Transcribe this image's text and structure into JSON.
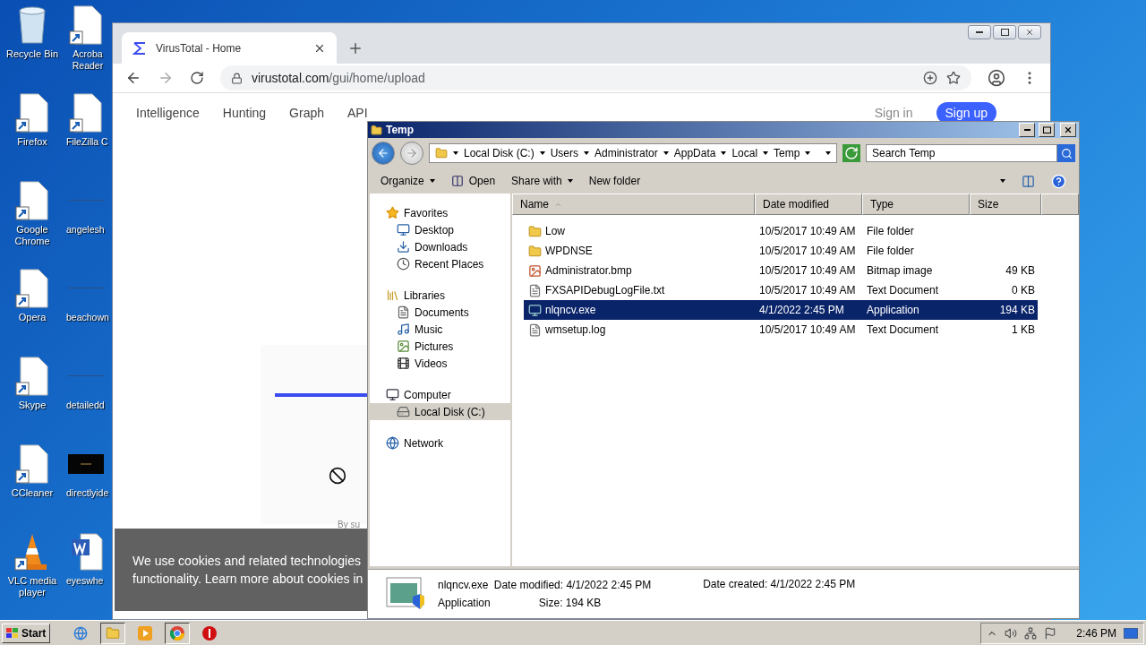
{
  "desktop": {
    "icons": [
      {
        "label": "Recycle Bin",
        "kind": "bin"
      },
      {
        "label": "Firefox",
        "kind": "shortcut"
      },
      {
        "label": "Google Chrome",
        "kind": "shortcut"
      },
      {
        "label": "Opera",
        "kind": "shortcut"
      },
      {
        "label": "Skype",
        "kind": "shortcut"
      },
      {
        "label": "CCleaner",
        "kind": "shortcut"
      },
      {
        "label": "VLC media player",
        "kind": "vlc"
      },
      {
        "label": "Acroba Reader",
        "kind": "shortcut"
      },
      {
        "label": "FileZilla C",
        "kind": "shortcut"
      },
      {
        "label": "angelesh",
        "kind": "blank"
      },
      {
        "label": "beachown",
        "kind": "blank"
      },
      {
        "label": "detailedd",
        "kind": "blank"
      },
      {
        "label": "directlyide",
        "kind": "thumbnail"
      },
      {
        "label": "eyeswhe",
        "kind": "word"
      }
    ]
  },
  "browser": {
    "tab": {
      "title": "VirusTotal - Home"
    },
    "address": {
      "host": "virustotal.com",
      "path": "/gui/home/upload"
    },
    "nav": [
      "Intelligence",
      "Hunting",
      "Graph",
      "API"
    ],
    "sign_in": "Sign in",
    "sign_up": "Sign up",
    "card": {
      "caption": "By su",
      "progress": {
        "level": 1
      }
    },
    "cookie_banner": {
      "lines": [
        "We use cookies and related technologies",
        "functionality. Learn more about cookies in"
      ]
    }
  },
  "explorer": {
    "title": "Temp",
    "breadcrumb": [
      "Local Disk (C:)",
      "Users",
      "Administrator",
      "AppData",
      "Local",
      "Temp"
    ],
    "search": {
      "placeholder": "Search Temp"
    },
    "toolbar": [
      {
        "label": "Organize",
        "kind": "menu"
      },
      {
        "label": "Open",
        "kind": "open"
      },
      {
        "label": "Share with",
        "kind": "menu"
      },
      {
        "label": "New folder",
        "kind": "plain"
      }
    ],
    "nav": [
      {
        "label": "Favorites",
        "kind": "star",
        "selected": false,
        "children": [
          {
            "label": "Desktop",
            "kind": "desktop",
            "selected": false
          },
          {
            "label": "Downloads",
            "kind": "downloads",
            "selected": false
          },
          {
            "label": "Recent Places",
            "kind": "recent",
            "selected": false
          }
        ]
      },
      {
        "label": "Libraries",
        "kind": "library",
        "selected": false,
        "children": [
          {
            "label": "Documents",
            "kind": "documents",
            "selected": false
          },
          {
            "label": "Music",
            "kind": "music",
            "selected": false
          },
          {
            "label": "Pictures",
            "kind": "pictures",
            "selected": false
          },
          {
            "label": "Videos",
            "kind": "videos",
            "selected": false
          }
        ]
      },
      {
        "label": "Computer",
        "kind": "computer",
        "selected": false,
        "children": [
          {
            "label": "Local Disk (C:)",
            "kind": "disk",
            "selected": true
          }
        ]
      },
      {
        "label": "Network",
        "kind": "network",
        "selected": false
      }
    ],
    "columns": [
      "Name",
      "Date modified",
      "Type",
      "Size"
    ],
    "files": [
      {
        "name": "Low",
        "date": "10/5/2017 10:49 AM",
        "type": "File folder",
        "kind": "folder",
        "selected": false
      },
      {
        "name": "WPDNSE",
        "date": "10/5/2017 10:49 AM",
        "type": "File folder",
        "kind": "folder",
        "selected": false
      },
      {
        "name": "Administrator.bmp",
        "date": "10/5/2017 10:49 AM",
        "type": "Bitmap image",
        "size": "49 KB",
        "kind": "bitmap",
        "selected": false
      },
      {
        "name": "FXSAPIDebugLogFile.txt",
        "date": "10/5/2017 10:49 AM",
        "type": "Text Document",
        "size": "0 KB",
        "kind": "text",
        "selected": false
      },
      {
        "name": "nlqncv.exe",
        "date": "4/1/2022 2:45 PM",
        "type": "Application",
        "size": "194 KB",
        "kind": "app",
        "selected": true
      },
      {
        "name": "wmsetup.log",
        "date": "10/5/2017 10:49 AM",
        "type": "Text Document",
        "size": "1 KB",
        "kind": "text",
        "selected": false
      }
    ],
    "details": {
      "name": "nlqncv.exe",
      "type": "Application",
      "modified": "Date modified: 4/1/2022 2:45 PM",
      "size": "Size: 194 KB",
      "created": "Date created: 4/1/2022 2:45 PM"
    }
  },
  "taskbar": {
    "start": "Start",
    "clock": "2:46 PM"
  }
}
